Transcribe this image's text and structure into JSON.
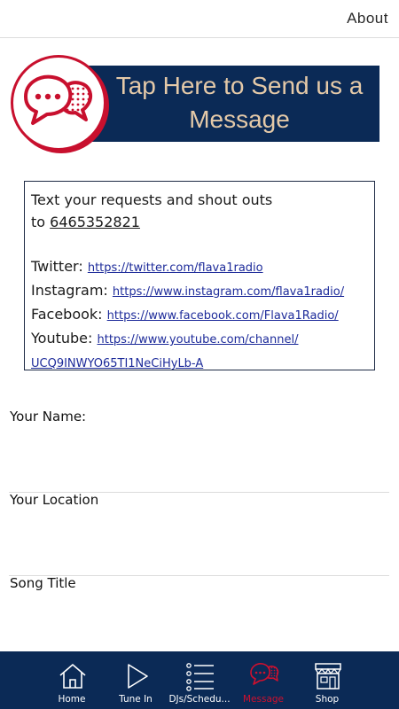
{
  "header": {
    "about_label": "About"
  },
  "banner": {
    "text": "Tap Here to Send us a Message"
  },
  "info": {
    "line1": "Text your requests and shout outs",
    "line2_prefix": "to ",
    "phone": "6465352821",
    "twitter_label": "Twitter:",
    "twitter_url": "https://twitter.com/flava1radio",
    "instagram_label": "Instagram:",
    "instagram_url": "https://www.instagram.com/flava1radio/",
    "facebook_label": "Facebook:",
    "facebook_url": "https://www.facebook.com/Flava1Radio/",
    "youtube_label": "Youtube:",
    "youtube_url_part1": "https://www.youtube.com/channel/",
    "youtube_url_part2": "UCQ9INWYO65TI1NeCiHyLb-A"
  },
  "form": {
    "fields": [
      {
        "label": "Your Name:",
        "value": ""
      },
      {
        "label": "Your Location",
        "value": ""
      },
      {
        "label": "Song Title",
        "value": ""
      }
    ]
  },
  "tabs": [
    {
      "label": "Home",
      "icon": "home-icon"
    },
    {
      "label": "Tune In",
      "icon": "play-icon"
    },
    {
      "label": "DJs/Schedu...",
      "icon": "list-icon"
    },
    {
      "label": "Message",
      "icon": "chat-bubbles-icon",
      "active": true
    },
    {
      "label": "Shop",
      "icon": "storefront-icon"
    }
  ],
  "colors": {
    "navy": "#0b2a56",
    "accent_red": "#c8102e",
    "banner_text": "#e4c9a8"
  }
}
